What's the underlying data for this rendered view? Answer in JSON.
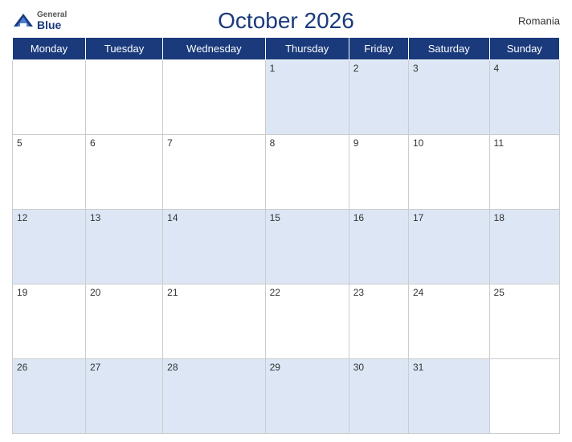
{
  "header": {
    "title": "October 2026",
    "country": "Romania",
    "logo": {
      "general": "General",
      "blue": "Blue"
    }
  },
  "weekdays": [
    "Monday",
    "Tuesday",
    "Wednesday",
    "Thursday",
    "Friday",
    "Saturday",
    "Sunday"
  ],
  "weeks": [
    [
      null,
      null,
      null,
      1,
      2,
      3,
      4
    ],
    [
      5,
      6,
      7,
      8,
      9,
      10,
      11
    ],
    [
      12,
      13,
      14,
      15,
      16,
      17,
      18
    ],
    [
      19,
      20,
      21,
      22,
      23,
      24,
      25
    ],
    [
      26,
      27,
      28,
      29,
      30,
      31,
      null
    ]
  ],
  "colors": {
    "header_bg": "#1a3a7c",
    "odd_row_bg": "#dce6f5",
    "even_row_bg": "#ffffff"
  }
}
